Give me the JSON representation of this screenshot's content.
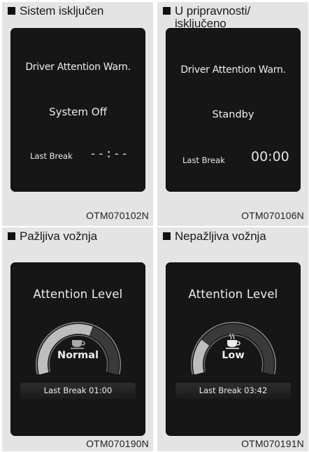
{
  "panels": [
    {
      "caption": "Sistem isključen",
      "title": "Driver Attention Warn.",
      "status": "System Off",
      "last_break_label": "Last Break",
      "last_break_value": "--:--",
      "code": "OTM070102N"
    },
    {
      "caption_line1": "U pripravnosti/",
      "caption_line2": "isključeno",
      "title": "Driver Attention Warn.",
      "status": "Standby",
      "last_break_label": "Last Break",
      "last_break_value": "00:00",
      "code": "OTM070106N"
    },
    {
      "caption": "Pažljiva vožnja",
      "title": "Attention Level",
      "level": "Normal",
      "last_break": "Last Break 01:00",
      "gauge_level": 0.6,
      "icon": "coffee-cup-icon",
      "code": "OTM070190N"
    },
    {
      "caption": "Nepažljiva vožnja",
      "title": "Attention Level",
      "level": "Low",
      "last_break": "Last Break 03:42",
      "gauge_level": 0.25,
      "icon": "steaming-coffee-cup-icon",
      "code": "OTM070191N"
    }
  ],
  "colors": {
    "panel_bg": "#e4e4e4",
    "screen_bg": "#161616",
    "screen_text": "#ededed"
  }
}
